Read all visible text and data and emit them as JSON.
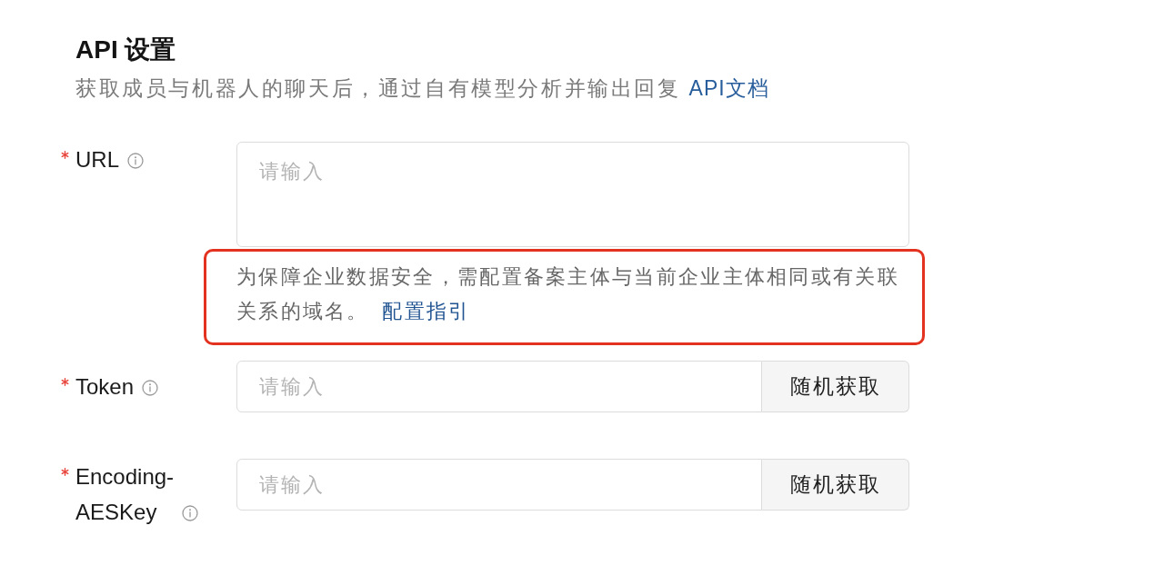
{
  "section": {
    "title": "API 设置",
    "description": "获取成员与机器人的聊天后，通过自有模型分析并输出回复",
    "doc_link": "API文档"
  },
  "fields": [
    {
      "kind": "textarea",
      "label": "URL",
      "required": true,
      "placeholder": "请输入",
      "help": {
        "text": "为保障企业数据安全，需配置备案主体与当前企业主体相同或有关联关系的域名。",
        "link": "配置指引",
        "highlighted": true
      }
    },
    {
      "kind": "input_button",
      "label": "Token",
      "required": true,
      "placeholder": "请输入",
      "button": "随机获取"
    },
    {
      "kind": "input_button",
      "label": "Encoding-AESKey",
      "required": true,
      "placeholder": "请输入",
      "button": "随机获取"
    }
  ]
}
